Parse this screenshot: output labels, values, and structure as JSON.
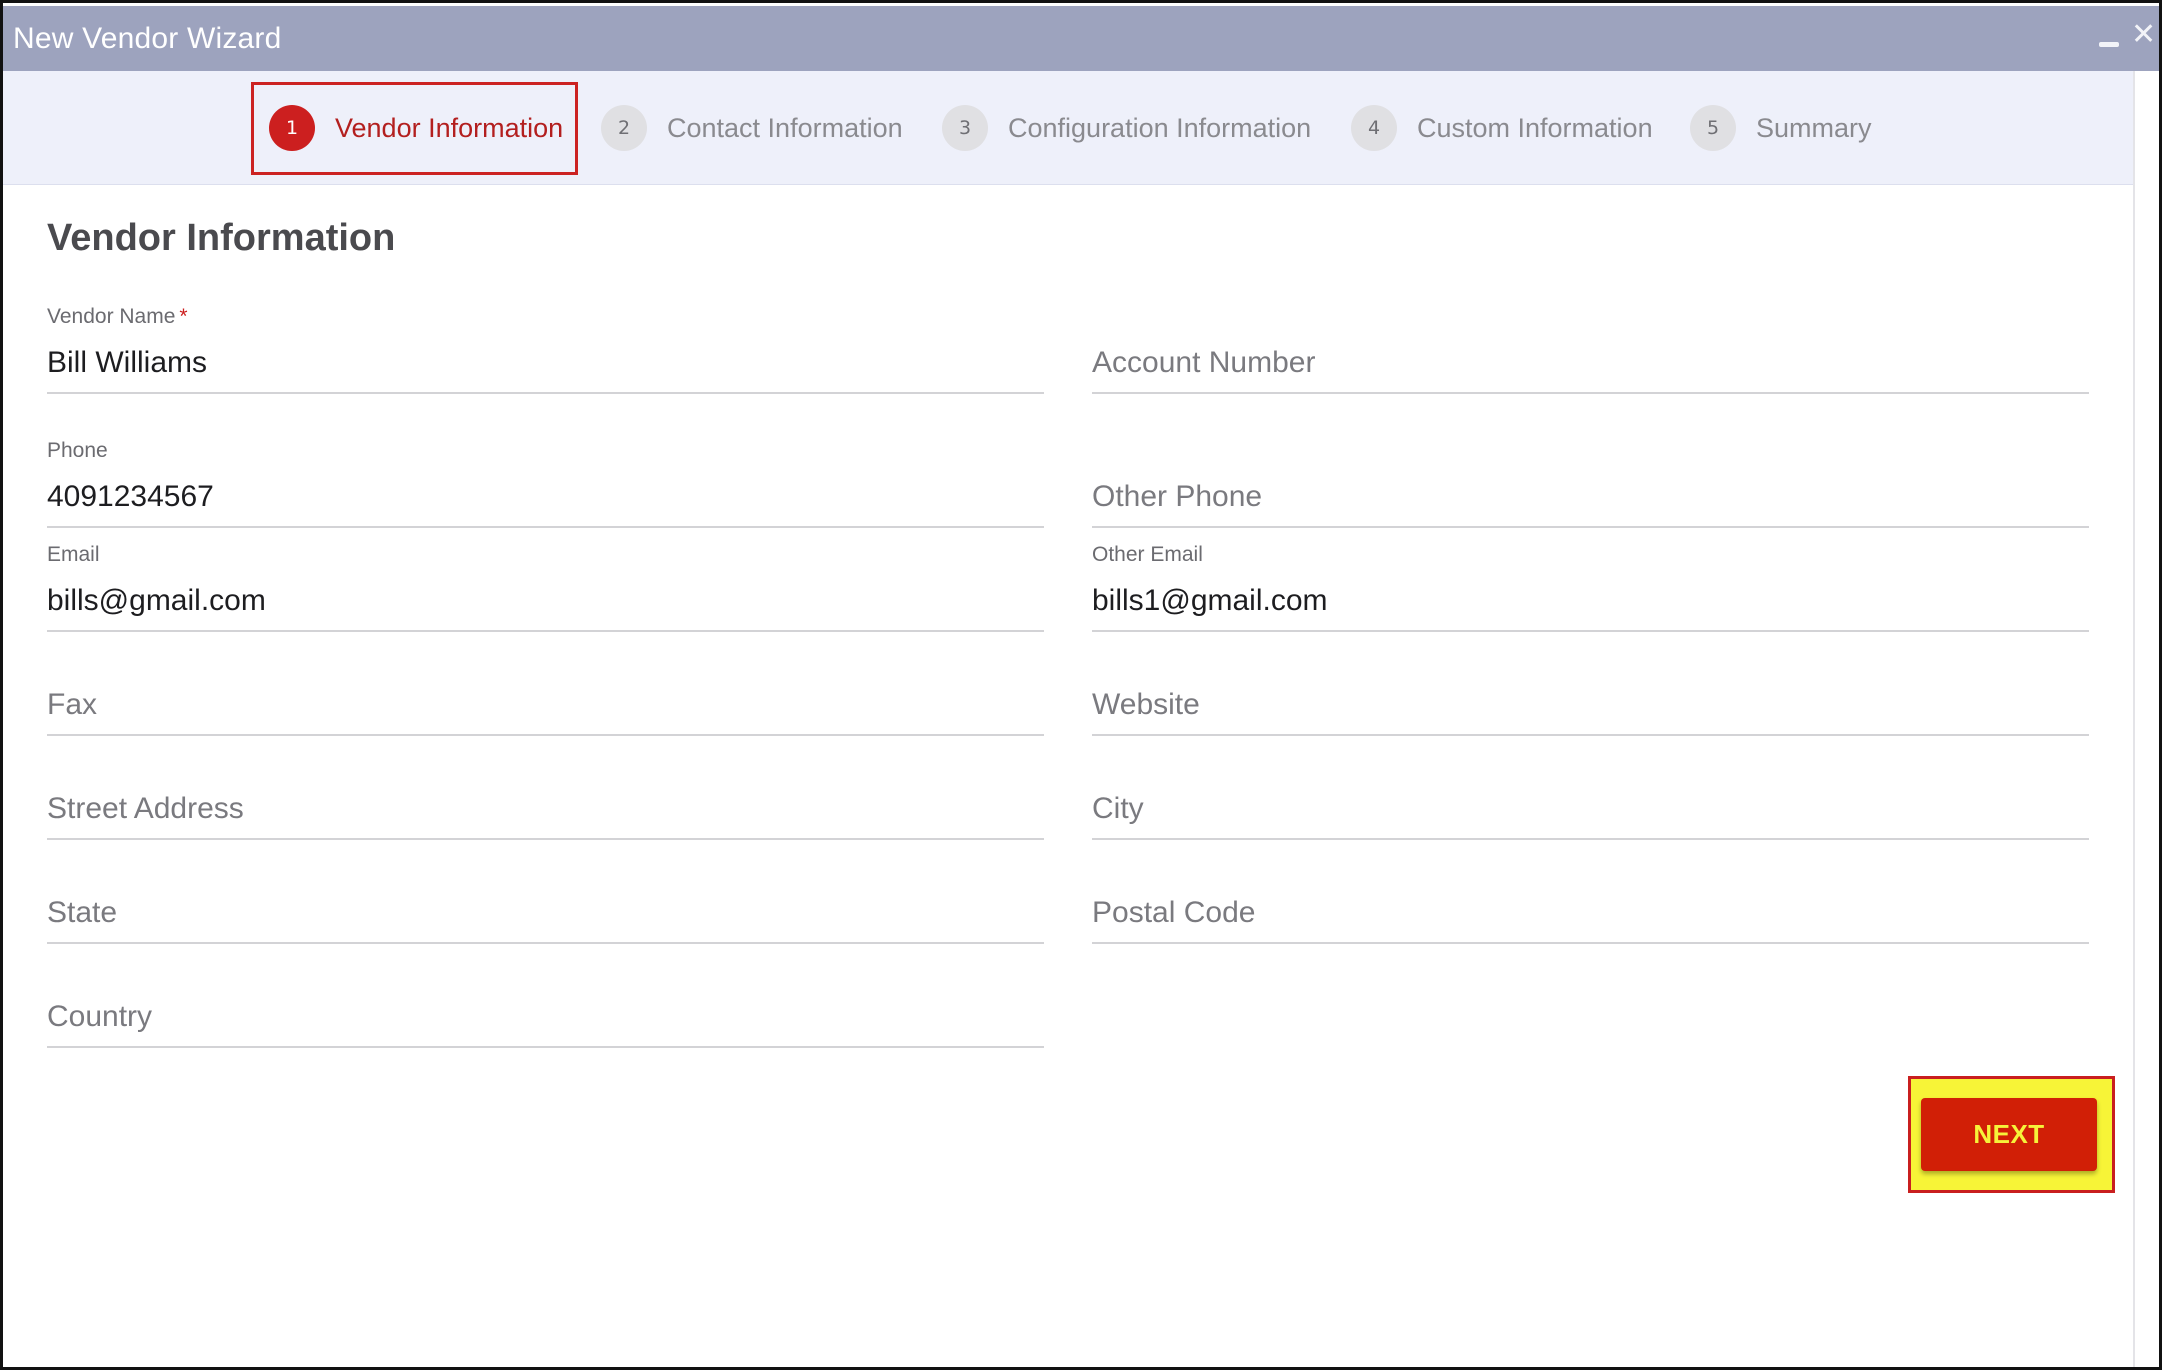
{
  "window": {
    "title": "New Vendor Wizard",
    "minimize_icon": "minimize-icon",
    "close_icon": "close-icon",
    "close_glyph": "✕"
  },
  "stepper": {
    "active_color": "#cc1f1f",
    "steps": [
      {
        "number": "1",
        "label": "Vendor Information",
        "active": true
      },
      {
        "number": "2",
        "label": "Contact Information",
        "active": false
      },
      {
        "number": "3",
        "label": "Configuration Information",
        "active": false
      },
      {
        "number": "4",
        "label": "Custom Information",
        "active": false
      },
      {
        "number": "5",
        "label": "Summary",
        "active": false
      }
    ]
  },
  "form": {
    "section_title": "Vendor Information",
    "vendor_name": {
      "label": "Vendor Name",
      "required_mark": "*",
      "value": "Bill Williams"
    },
    "account_number": {
      "placeholder": "Account Number",
      "value": ""
    },
    "phone": {
      "label": "Phone",
      "value": "4091234567"
    },
    "other_phone": {
      "placeholder": "Other Phone",
      "value": ""
    },
    "email": {
      "label": "Email",
      "value": "bills@gmail.com"
    },
    "other_email": {
      "label": "Other Email",
      "value": "bills1@gmail.com"
    },
    "fax": {
      "placeholder": "Fax",
      "value": ""
    },
    "website": {
      "placeholder": "Website",
      "value": ""
    },
    "street_address": {
      "placeholder": "Street Address",
      "value": ""
    },
    "city": {
      "placeholder": "City",
      "value": ""
    },
    "state": {
      "placeholder": "State",
      "value": ""
    },
    "postal_code": {
      "placeholder": "Postal Code",
      "value": ""
    },
    "country": {
      "placeholder": "Country",
      "value": ""
    }
  },
  "actions": {
    "next_label": "NEXT",
    "next_bg": "#d11f06",
    "highlight_color": "#f7f437"
  }
}
